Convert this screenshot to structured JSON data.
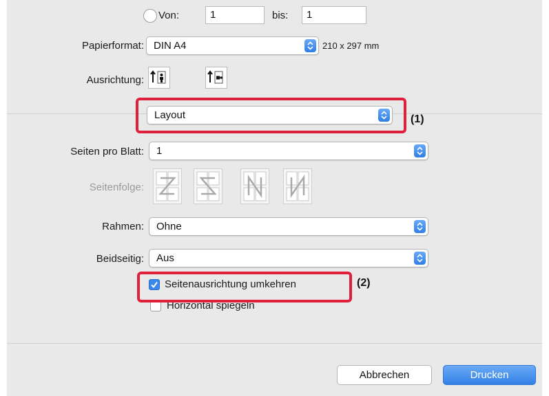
{
  "pages": {
    "from_label": "Von:",
    "from_value": "1",
    "to_label": "bis:",
    "to_value": "1"
  },
  "paper": {
    "label": "Papierformat:",
    "value": "DIN A4",
    "size_text": "210 x 297 mm"
  },
  "orientation": {
    "label": "Ausrichtung:",
    "options": [
      "portrait-icon",
      "landscape-icon"
    ]
  },
  "section": {
    "value": "Layout",
    "callout": "(1)"
  },
  "layout": {
    "pages_per_sheet_label": "Seiten pro Blatt:",
    "pages_per_sheet_value": "1",
    "page_order_label": "Seitenfolge:",
    "page_order_icons": [
      "z-order-icon",
      "reverse-z-order-icon",
      "n-order-icon",
      "reverse-n-order-icon"
    ],
    "border_label": "Rahmen:",
    "border_value": "Ohne",
    "duplex_label": "Beidseitig:",
    "duplex_value": "Aus",
    "reverse_orientation_label": "Seitenausrichtung umkehren",
    "reverse_orientation_checked": true,
    "reverse_callout": "(2)",
    "flip_horizontal_label": "Horizontal spiegeln",
    "flip_horizontal_checked": false
  },
  "buttons": {
    "cancel": "Abbrechen",
    "print": "Drucken"
  },
  "colors": {
    "accent": "#2f7fe6",
    "highlight": "#e0203a",
    "panel": "#e9e9e9"
  }
}
